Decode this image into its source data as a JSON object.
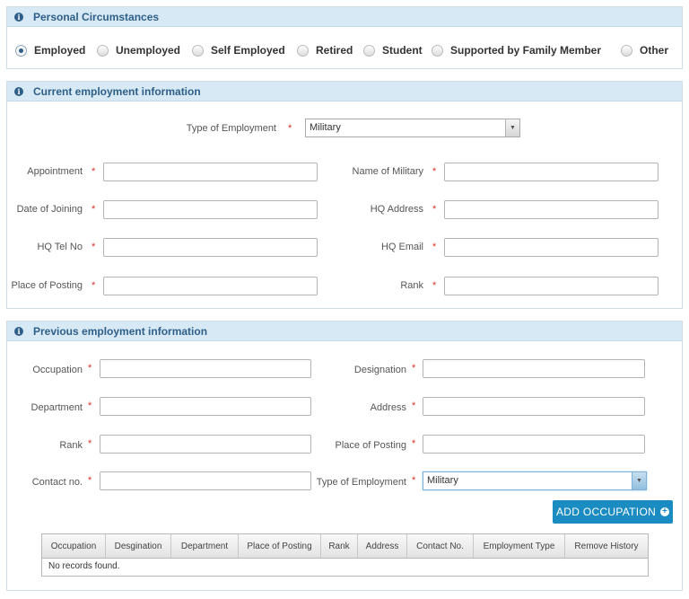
{
  "personal": {
    "title": "Personal Circumstances",
    "options": [
      "Employed",
      "Unemployed",
      "Self Employed",
      "Retired",
      "Student",
      "Supported by Family Member",
      "Other"
    ],
    "selected": "Employed"
  },
  "current": {
    "title": "Current employment information",
    "type_label": "Type of Employment",
    "type_value": "Military",
    "left_labels": [
      "Appointment",
      "Date of Joining",
      "HQ Tel No",
      "Place of Posting"
    ],
    "right_labels": [
      "Name of Military",
      "HQ Address",
      "HQ Email",
      "Rank"
    ]
  },
  "previous": {
    "title": "Previous employment information",
    "left_labels": [
      "Occupation",
      "Department",
      "Rank",
      "Contact no."
    ],
    "right_labels": [
      "Designation",
      "Address",
      "Place of Posting",
      "Type of Employment"
    ],
    "type_value": "Military",
    "add_button": "ADD OCCUPATION",
    "columns": [
      "Occupation",
      "Desgination",
      "Department",
      "Place of Posting",
      "Rank",
      "Address",
      "Contact No.",
      "Employment Type",
      "Remove History"
    ],
    "empty_text": "No records found."
  },
  "required_mark": "*",
  "colors": {
    "accent": "#1b8cc2",
    "header_bg": "#d6e9f4",
    "title": "#2f5f88",
    "required": "#d93025"
  }
}
